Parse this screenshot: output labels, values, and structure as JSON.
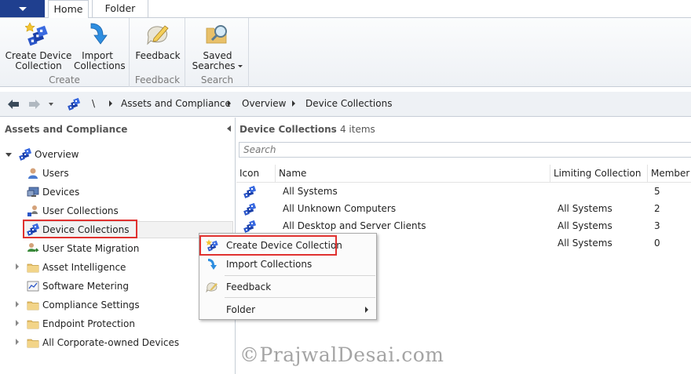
{
  "ribbon": {
    "tabs": [
      {
        "label": "Home"
      },
      {
        "label": "Folder"
      }
    ],
    "groups": {
      "create": {
        "label": "Create",
        "create_device_collection_line1": "Create Device",
        "create_device_collection_line2": "Collection",
        "import_collections_line1": "Import",
        "import_collections_line2": "Collections"
      },
      "feedback": {
        "label": "Feedback",
        "button": "Feedback"
      },
      "search": {
        "label": "Search",
        "saved_searches_line1": "Saved",
        "saved_searches_line2": "Searches"
      }
    }
  },
  "address": {
    "root": "\\",
    "crumbs": [
      "Assets and Compliance",
      "Overview",
      "Device Collections"
    ]
  },
  "left_pane": {
    "title": "Assets and Compliance",
    "tree": [
      {
        "label": "Overview",
        "icon": "overview-icon"
      },
      {
        "label": "Users",
        "icon": "user-icon"
      },
      {
        "label": "Devices",
        "icon": "devices-icon"
      },
      {
        "label": "User Collections",
        "icon": "user-collections-icon"
      },
      {
        "label": "Device Collections",
        "icon": "device-collection-icon"
      },
      {
        "label": "User State Migration",
        "icon": "user-state-migration-icon"
      },
      {
        "label": "Asset Intelligence",
        "icon": "folder-icon"
      },
      {
        "label": "Software Metering",
        "icon": "software-metering-icon"
      },
      {
        "label": "Compliance Settings",
        "icon": "folder-icon"
      },
      {
        "label": "Endpoint Protection",
        "icon": "folder-icon"
      },
      {
        "label": "All Corporate-owned Devices",
        "icon": "folder-icon"
      }
    ]
  },
  "right_pane": {
    "title": "Device Collections",
    "count": "4 items",
    "search_placeholder": "Search",
    "columns": [
      "Icon",
      "Name",
      "Limiting Collection",
      "Member C"
    ],
    "rows": [
      {
        "name": "All Systems",
        "limiting": "",
        "members": "5"
      },
      {
        "name": "All Unknown Computers",
        "limiting": "All Systems",
        "members": "2"
      },
      {
        "name": "All Desktop and Server Clients",
        "limiting": "All Systems",
        "members": "3"
      },
      {
        "name": "",
        "limiting": "All Systems",
        "members": "0"
      }
    ]
  },
  "context_menu": {
    "items": [
      {
        "label": "Create Device Collection",
        "icon": "create-collection-icon"
      },
      {
        "label": "Import Collections",
        "icon": "import-arrow-icon"
      },
      {
        "label": "Feedback",
        "icon": "feedback-icon"
      },
      {
        "label": "Folder",
        "icon": ""
      }
    ]
  },
  "watermark": "©PrajwalDesai.com",
  "colors": {
    "app_menu": "#1f3f8f",
    "highlight": "#e0312f"
  }
}
